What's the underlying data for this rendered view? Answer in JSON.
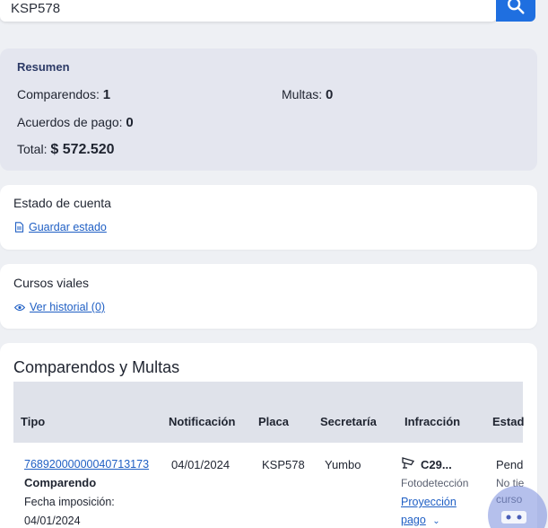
{
  "search": {
    "value": "KSP578"
  },
  "summary": {
    "title": "Resumen",
    "comparendos_label": "Comparendos:",
    "comparendos_value": "1",
    "multas_label": "Multas:",
    "multas_value": "0",
    "acuerdos_label": "Acuerdos de pago:",
    "acuerdos_value": "0",
    "total_label": "Total:",
    "total_value": "$ 572.520"
  },
  "estado_cuenta": {
    "title": "Estado de cuenta",
    "link": "Guardar estado",
    "icon": "document-icon"
  },
  "cursos": {
    "title": "Cursos viales",
    "link": "Ver historial (0)",
    "icon": "eye-icon"
  },
  "table": {
    "title": "Comparendos y Multas",
    "headers": [
      "Tipo",
      "Notificación",
      "Placa",
      "Secretaría",
      "Infracción",
      "Estad"
    ],
    "rows": [
      {
        "tipo_id": "76892000000040713173",
        "tipo_kind": "Comparendo",
        "fecha_label": "Fecha imposición:",
        "fecha_value": "04/01/2024",
        "notificacion": "04/01/2024",
        "placa": "KSP578",
        "secretaria": "Yumbo",
        "infraccion_code": "C29...",
        "infraccion_type": "Fotodetección",
        "infraccion_link_1": "Proyección",
        "infraccion_link_2": "pago",
        "estado": "Pend",
        "estado_sub_1": "No tie",
        "estado_sub_2": "curso"
      }
    ]
  },
  "colors": {
    "accent": "#1f6fe0",
    "link": "#1f5fc4",
    "summary_bg": "#e4e6ef"
  }
}
